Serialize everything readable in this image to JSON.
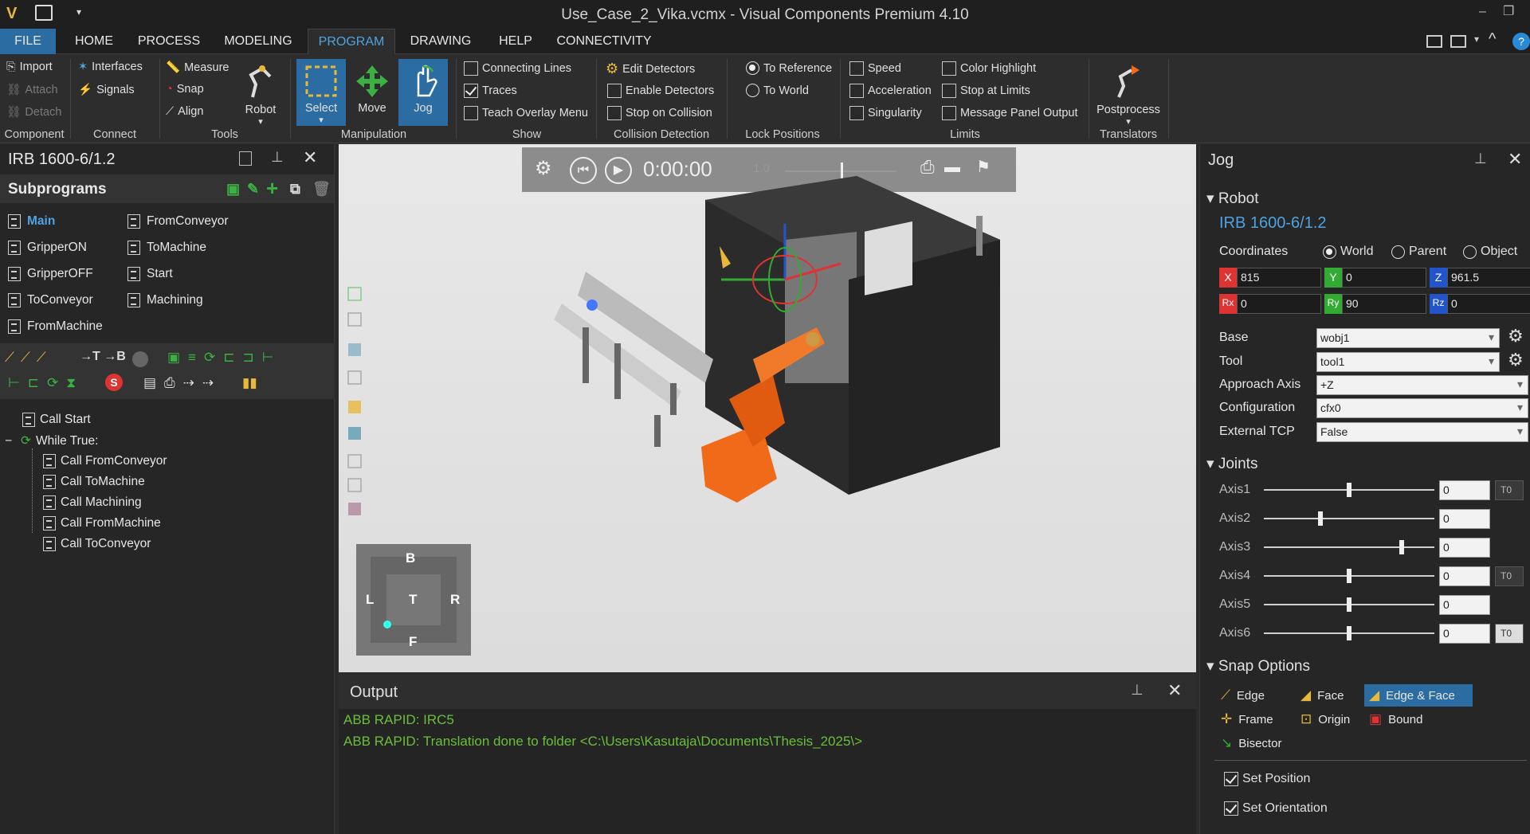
{
  "window": {
    "title": "Use_Case_2_Vika.vcmx - Visual Components Premium 4.10"
  },
  "menu": {
    "tabs": [
      "FILE",
      "HOME",
      "PROCESS",
      "MODELING",
      "PROGRAM",
      "DRAWING",
      "HELP",
      "CONNECTIVITY"
    ],
    "active": "PROGRAM"
  },
  "ribbon": {
    "component": {
      "import": "Import",
      "attach": "Attach",
      "detach": "Detach",
      "group": "Component"
    },
    "connect": {
      "interfaces": "Interfaces",
      "signals": "Signals",
      "group": "Connect"
    },
    "tools": {
      "measure": "Measure",
      "snap": "Snap",
      "align": "Align",
      "robot": "Robot",
      "group": "Tools"
    },
    "manipulation": {
      "select": "Select",
      "move": "Move",
      "jog": "Jog",
      "group": "Manipulation"
    },
    "show": {
      "connecting_lines": "Connecting Lines",
      "traces": "Traces",
      "teach_overlay": "Teach Overlay Menu",
      "group": "Show"
    },
    "collision": {
      "edit": "Edit Detectors",
      "enable": "Enable Detectors",
      "stop": "Stop on Collision",
      "group": "Collision Detection"
    },
    "lock": {
      "to_reference": "To Reference",
      "to_world": "To World",
      "group": "Lock Positions"
    },
    "limits": {
      "speed": "Speed",
      "acceleration": "Acceleration",
      "singularity": "Singularity",
      "color_highlight": "Color Highlight",
      "stop_at_limits": "Stop at Limits",
      "message_panel": "Message Panel Output",
      "group": "Limits"
    },
    "translators": {
      "postprocess": "Postprocess",
      "group": "Translators"
    }
  },
  "left": {
    "robot_name": "IRB 1600-6/1.2",
    "subprograms_title": "Subprograms",
    "subprograms": [
      "Main",
      "FromConveyor",
      "GripperON",
      "ToMachine",
      "GripperOFF",
      "Start",
      "ToConveyor",
      "Machining",
      "FromMachine"
    ],
    "tree": {
      "call_start": "Call Start",
      "while": "While True:",
      "children": [
        "Call FromConveyor",
        "Call ToMachine",
        "Call Machining",
        "Call FromMachine",
        "Call ToConveyor"
      ]
    }
  },
  "sim": {
    "time": "0:00:00",
    "speed": "1.0"
  },
  "cube": {
    "top": "B",
    "left": "L",
    "center": "T",
    "right": "R",
    "bottom": "F"
  },
  "output": {
    "title": "Output",
    "lines": [
      "ABB RAPID: IRC5",
      "ABB RAPID: Translation done to folder <C:\\Users\\Kasutaja\\Documents\\Thesis_2025\\>"
    ]
  },
  "jog": {
    "title": "Jog",
    "robot_section": "Robot",
    "robot_name": "IRB 1600-6/1.2",
    "coordinates_label": "Coordinates",
    "coord_options": [
      "World",
      "Parent",
      "Object"
    ],
    "x": "815",
    "y": "0",
    "z": "961.5",
    "rx": "0",
    "ry": "90",
    "rz": "0",
    "base_label": "Base",
    "base": "wobj1",
    "tool_label": "Tool",
    "tool": "tool1",
    "approach_label": "Approach Axis",
    "approach": "+Z",
    "config_label": "Configuration",
    "config": "cfx0",
    "ext_tcp_label": "External TCP",
    "ext_tcp": "False",
    "joints_section": "Joints",
    "axes": [
      {
        "name": "Axis1",
        "value": "0"
      },
      {
        "name": "Axis2",
        "value": "0"
      },
      {
        "name": "Axis3",
        "value": "0"
      },
      {
        "name": "Axis4",
        "value": "0"
      },
      {
        "name": "Axis5",
        "value": "0"
      },
      {
        "name": "Axis6",
        "value": "0"
      }
    ],
    "t0": "T0",
    "snap_section": "Snap Options",
    "snap": {
      "edge": "Edge",
      "face": "Face",
      "edge_face": "Edge & Face",
      "frame": "Frame",
      "origin": "Origin",
      "bound": "Bound",
      "bisector": "Bisector"
    },
    "set_position": "Set Position",
    "set_orientation": "Set Orientation"
  },
  "colors": {
    "accent": "#2b6ca3",
    "robot_orange": "#f06a1a",
    "output_green": "#6abf3a",
    "x_red": "#d33",
    "y_green": "#3a3",
    "z_blue": "#25c"
  }
}
